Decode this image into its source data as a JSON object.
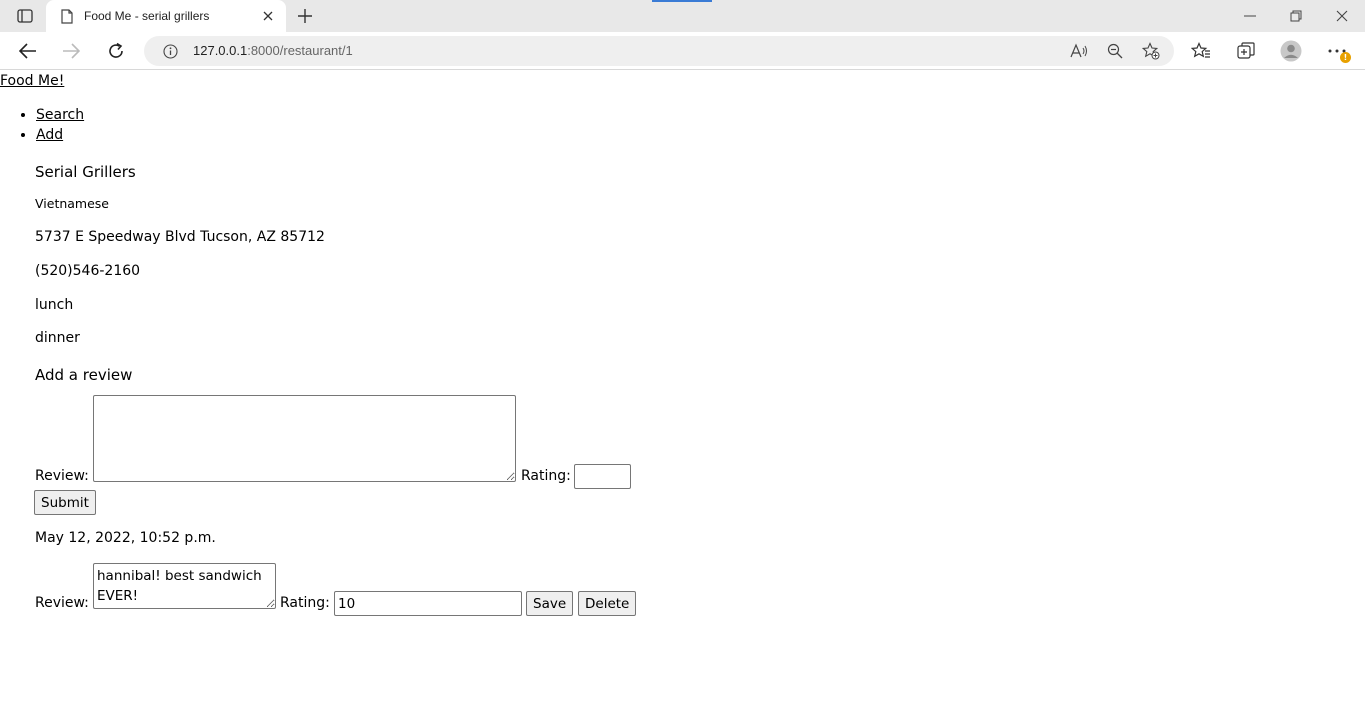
{
  "browser": {
    "tab_title": "Food Me - serial grillers",
    "url_host": "127.0.0.1",
    "url_rest": ":8000/restaurant/1",
    "notification_badge": "!"
  },
  "site": {
    "title": "Food Me!",
    "nav": [
      "Search",
      "Add"
    ]
  },
  "restaurant": {
    "name": "Serial Grillers",
    "cuisine": "Vietnamese",
    "address": "5737 E Speedway Blvd Tucson, AZ 85712",
    "phone": "(520)546-2160",
    "meals": [
      "lunch",
      "dinner"
    ]
  },
  "new_review": {
    "heading": "Add a review",
    "review_label": "Review:",
    "review_value": "",
    "rating_label": "Rating:",
    "rating_value": "",
    "submit_label": "Submit"
  },
  "reviews": [
    {
      "date": "May 12, 2022, 10:52 p.m.",
      "review_label": "Review:",
      "review_text": "hannibal! best sandwich EVER!",
      "rating_label": "Rating:",
      "rating_value": "10",
      "save_label": "Save",
      "delete_label": "Delete"
    }
  ]
}
